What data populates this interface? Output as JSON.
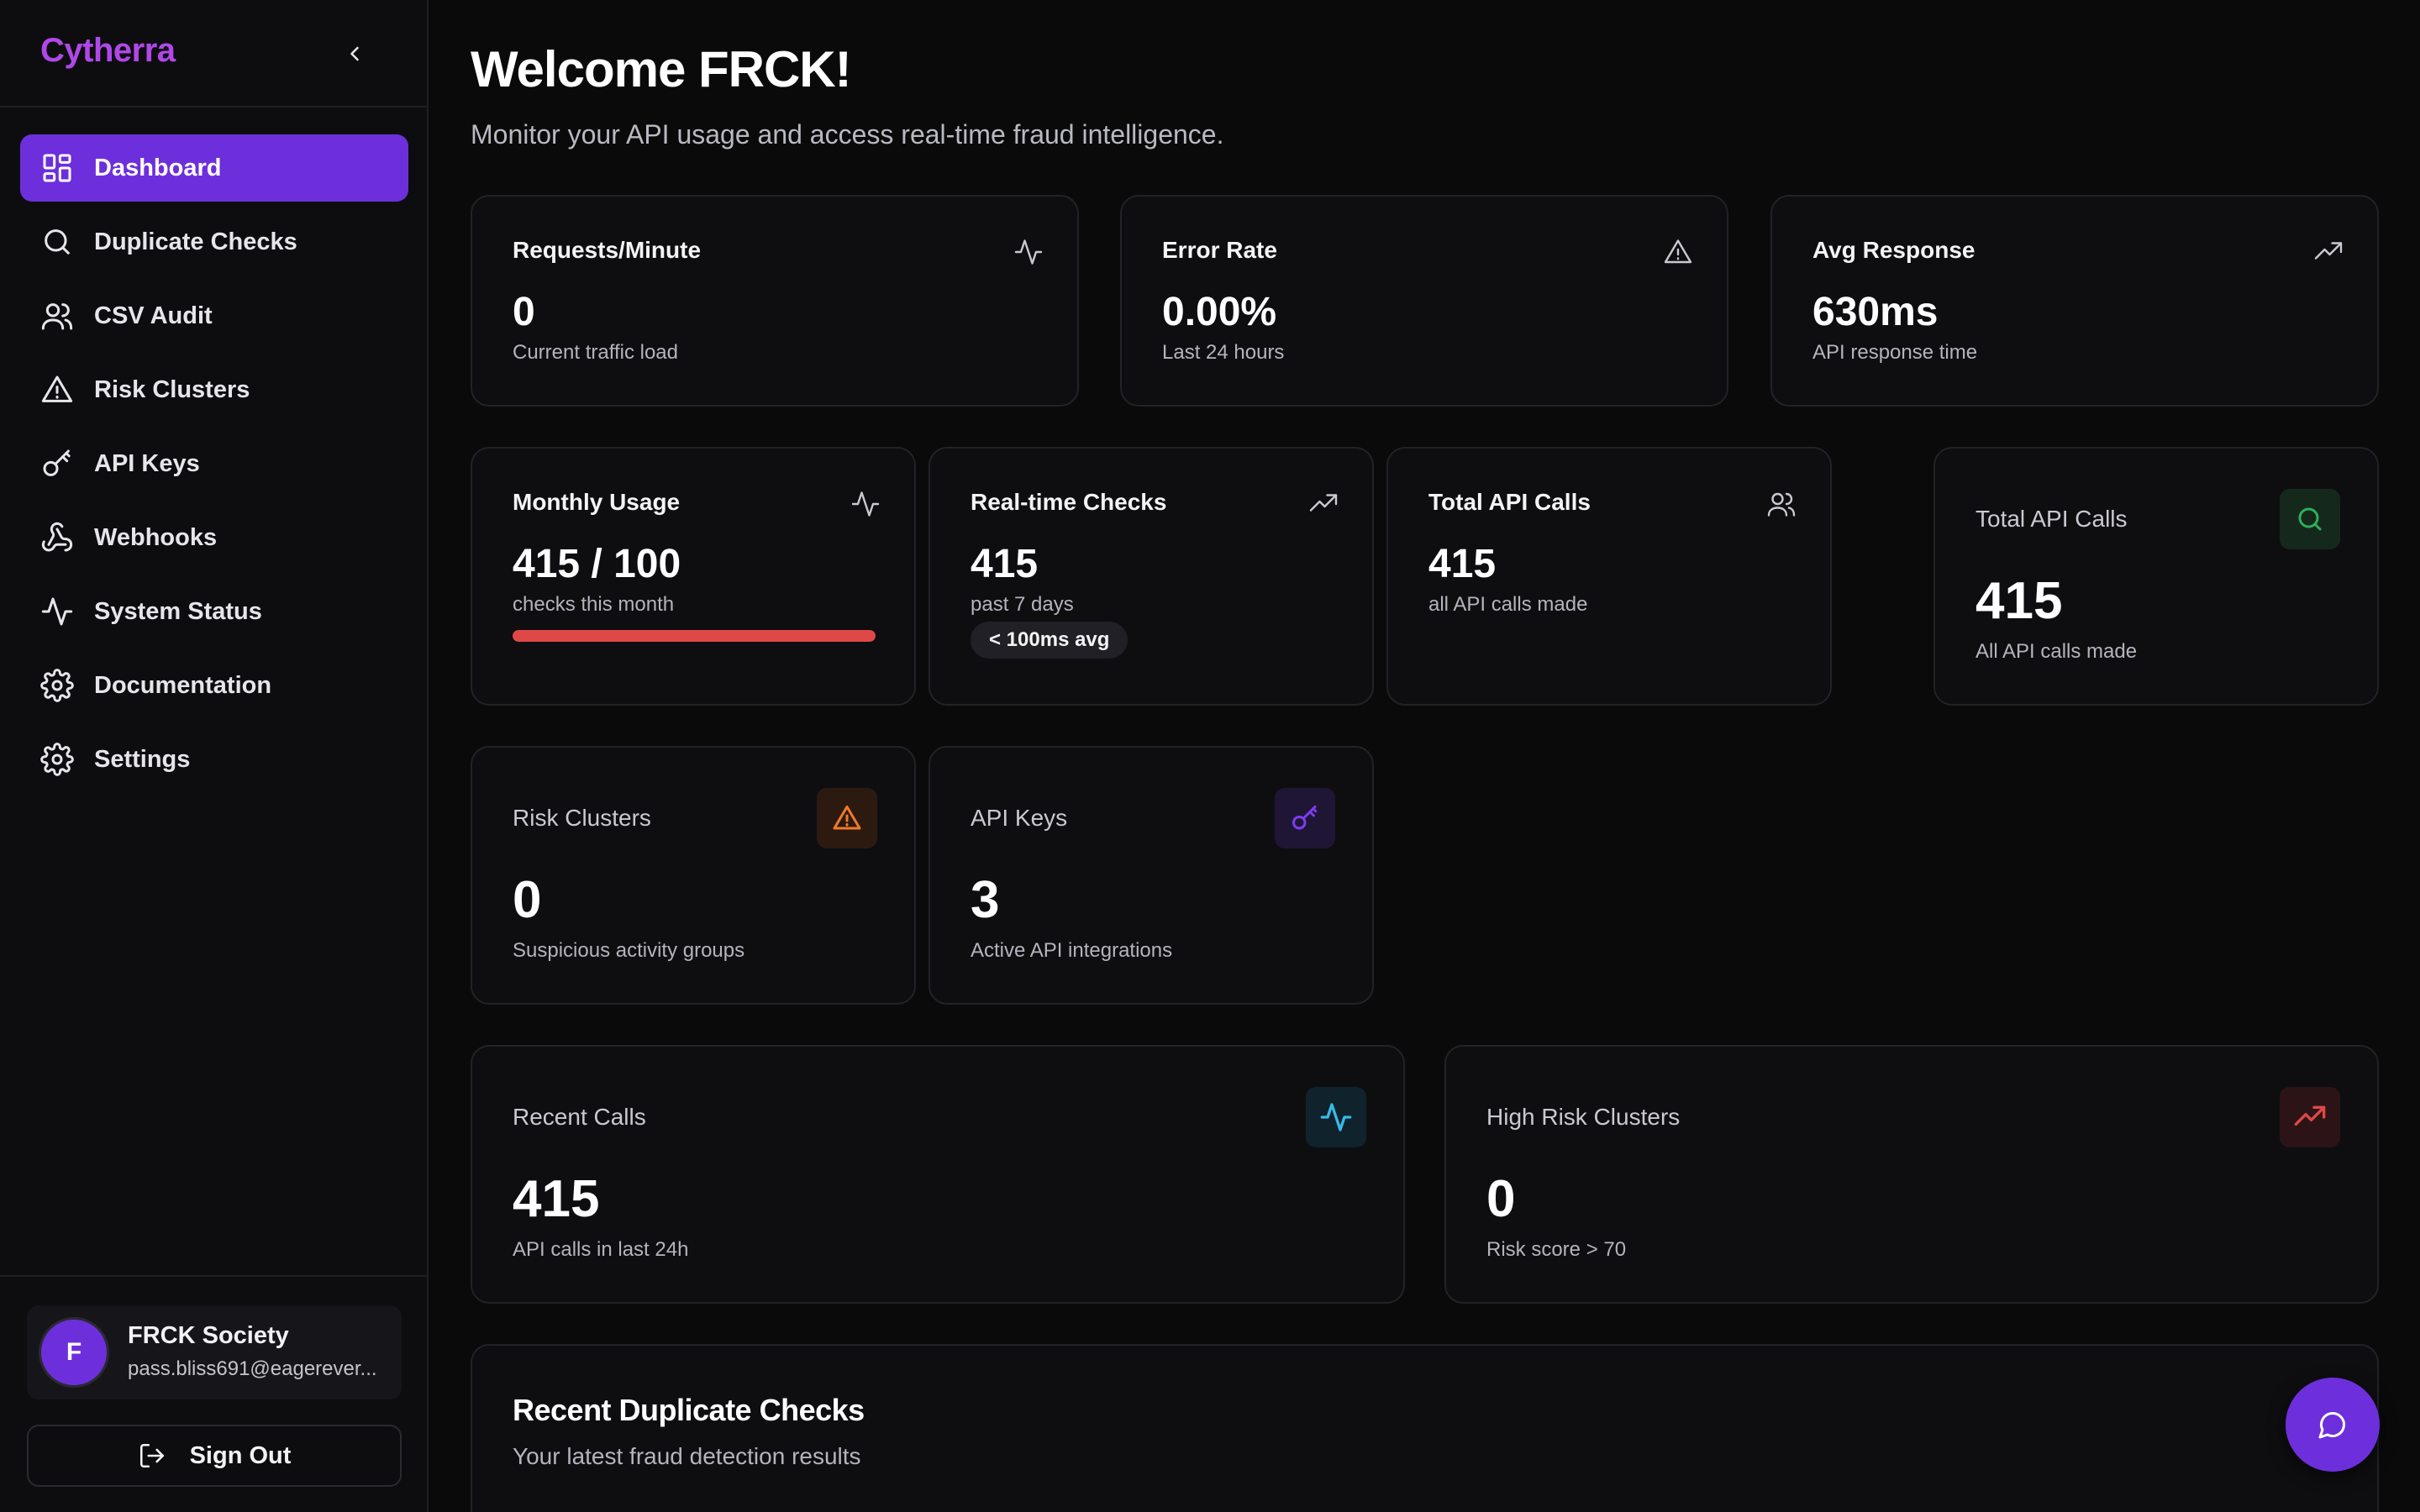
{
  "app": {
    "brand": "Cytherra"
  },
  "sidebar": {
    "items": [
      {
        "label": "Dashboard",
        "icon": "dashboard-icon",
        "active": true
      },
      {
        "label": "Duplicate Checks",
        "icon": "search-icon"
      },
      {
        "label": "CSV Audit",
        "icon": "users-icon"
      },
      {
        "label": "Risk Clusters",
        "icon": "warning-icon"
      },
      {
        "label": "API Keys",
        "icon": "key-icon"
      },
      {
        "label": "Webhooks",
        "icon": "webhook-icon"
      },
      {
        "label": "System Status",
        "icon": "activity-icon"
      },
      {
        "label": "Documentation",
        "icon": "gear-icon"
      },
      {
        "label": "Settings",
        "icon": "gear-icon"
      }
    ],
    "user": {
      "initial": "F",
      "name": "FRCK Society",
      "email": "pass.bliss691@eagerever..."
    },
    "signout_label": "Sign Out"
  },
  "header": {
    "title": "Welcome FRCK!",
    "subtitle": "Monitor your API usage and access real-time fraud intelligence."
  },
  "stats_row1": [
    {
      "title": "Requests/Minute",
      "value": "0",
      "sub": "Current traffic load",
      "icon": "activity-icon"
    },
    {
      "title": "Error Rate",
      "value": "0.00%",
      "sub": "Last 24 hours",
      "icon": "warning-icon"
    },
    {
      "title": "Avg Response",
      "value": "630ms",
      "sub": "API response time",
      "icon": "trending-up-icon"
    }
  ],
  "stats_row2": [
    {
      "title": "Monthly Usage",
      "value": "415 / 100",
      "sub": "checks this month",
      "icon": "activity-icon",
      "progress": 1.0
    },
    {
      "title": "Real-time Checks",
      "value": "415",
      "sub": "past 7 days",
      "badge": "< 100ms avg",
      "icon": "trending-up-icon"
    },
    {
      "title": "Total API Calls",
      "value": "415",
      "sub": "all API calls made",
      "icon": "users-icon"
    },
    {
      "title": "Total API Calls",
      "value": "415",
      "sub": "All API calls made",
      "icon": "search-icon"
    }
  ],
  "stats_row3": [
    {
      "title": "Risk Clusters",
      "value": "0",
      "sub": "Suspicious activity groups",
      "icon": "warning-icon"
    },
    {
      "title": "API Keys",
      "value": "3",
      "sub": "Active API integrations",
      "icon": "key-icon"
    }
  ],
  "stats_row4": [
    {
      "title": "Recent Calls",
      "value": "415",
      "sub": "API calls in last 24h",
      "icon": "activity-icon"
    },
    {
      "title": "High Risk Clusters",
      "value": "0",
      "sub": "Risk score > 70",
      "icon": "trending-up-icon"
    }
  ],
  "recent_checks": {
    "title": "Recent Duplicate Checks",
    "subtitle": "Your latest fraud detection results"
  },
  "colors": {
    "accent": "#6d2fdc",
    "brand": "#b048e8",
    "danger": "#e04848",
    "warning": "#f07a2a",
    "success": "#2fae5a",
    "info": "#3ab8e8"
  }
}
